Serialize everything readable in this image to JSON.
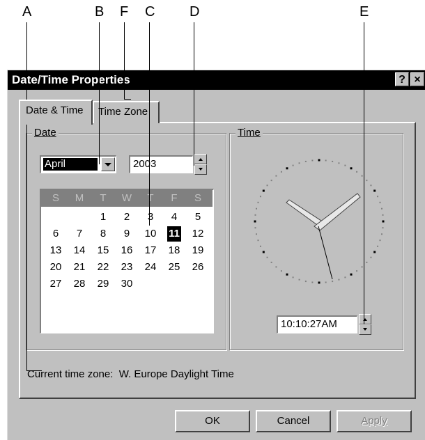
{
  "callouts": {
    "a": "A",
    "b": "B",
    "c": "C",
    "d": "D",
    "e": "E",
    "f": "F"
  },
  "window": {
    "title": "Date/Time Properties",
    "help_label": "?",
    "close_label": "×"
  },
  "tabs": [
    {
      "label": "Date & Time"
    },
    {
      "label": "Time Zone"
    }
  ],
  "date_group": {
    "label": "Date",
    "month": "April",
    "year": "2003",
    "weekdays": [
      "S",
      "M",
      "T",
      "W",
      "T",
      "F",
      "S"
    ],
    "weeks": [
      [
        "",
        "",
        "1",
        "2",
        "3",
        "4",
        "5"
      ],
      [
        "6",
        "7",
        "8",
        "9",
        "10",
        "11",
        "12"
      ],
      [
        "13",
        "14",
        "15",
        "16",
        "17",
        "18",
        "19"
      ],
      [
        "20",
        "21",
        "22",
        "23",
        "24",
        "25",
        "26"
      ],
      [
        "27",
        "28",
        "29",
        "30",
        "",
        "",
        ""
      ]
    ],
    "selected_day": "11"
  },
  "time_group": {
    "label": "Time",
    "time": "10:10:27AM"
  },
  "timezone_text": "Current time zone:  W. Europe Daylight Time",
  "buttons": {
    "ok": "OK",
    "cancel": "Cancel",
    "apply": "Apply"
  },
  "colors": {
    "titlebar": "#000000",
    "face": "#c0c0c0",
    "calendar_header": "#808080",
    "disabled_text": "#808080"
  }
}
